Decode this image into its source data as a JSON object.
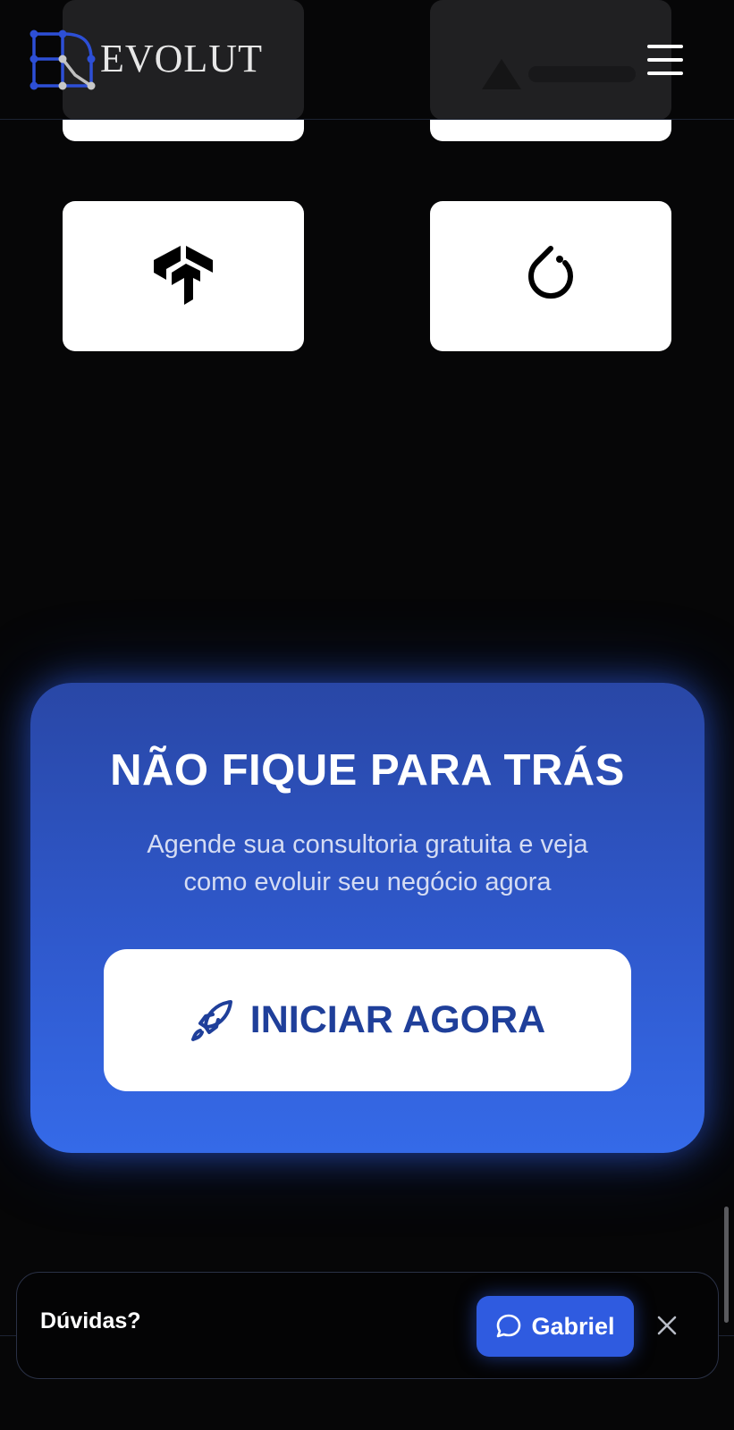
{
  "header": {
    "brand_name": "EVOLUT",
    "logo_icon": "circuit-e-logo-icon",
    "menu_icon": "hamburger-menu-icon"
  },
  "partners": [
    {
      "name": "logo-card-top-left",
      "icon": "partial-logo"
    },
    {
      "name": "logo-card-top-right",
      "icon": "partial-logo"
    },
    {
      "name": "tensorflow-card",
      "icon": "tensorflow-icon"
    },
    {
      "name": "pytorch-card",
      "icon": "pytorch-icon"
    }
  ],
  "cta": {
    "title": "NÃO FIQUE PARA TRÁS",
    "subtitle_line1": "Agende sua consultoria gratuita e veja",
    "subtitle_line2": "como evoluir seu negócio agora",
    "button_label": "INICIAR AGORA",
    "button_icon": "rocket-icon"
  },
  "chat": {
    "question": "Dúvidas?",
    "agent_button_label": "Gabriel",
    "agent_icon": "chat-bubble-icon",
    "close_icon": "close-icon"
  },
  "colors": {
    "background": "#060607",
    "cta_gradient_top": "#2947a6",
    "cta_gradient_bottom": "#356ae8",
    "cta_button_text": "#1f3f9a",
    "chat_button": "#2f5be0",
    "logo_blue": "#2d4fd6"
  }
}
